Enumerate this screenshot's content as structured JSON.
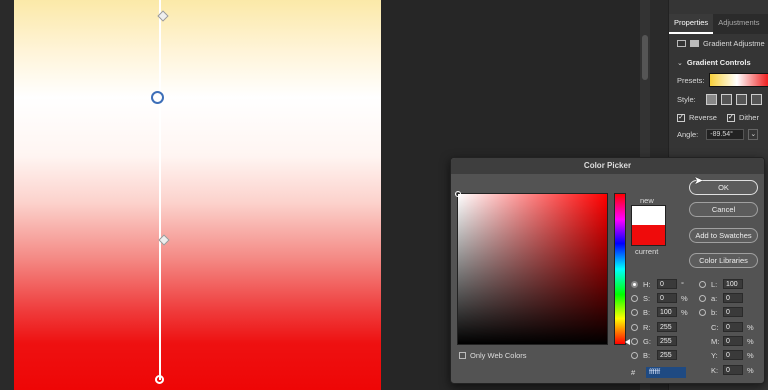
{
  "properties": {
    "tabs": [
      "Properties",
      "Adjustments"
    ],
    "layer_label": "Gradient Adjustme",
    "section_title": "Gradient Controls",
    "presets_label": "Presets:",
    "style_label": "Style:",
    "reverse_label": "Reverse",
    "dither_label": "Dither",
    "angle_label": "Angle:",
    "angle_value": "-89.54°"
  },
  "dialog": {
    "title": "Color Picker",
    "new_label": "new",
    "current_label": "current",
    "new_color": "#ffffff",
    "current_color": "#ef0b0b",
    "ok_label": "OK",
    "cancel_label": "Cancel",
    "add_swatches_label": "Add to Swatches",
    "color_libraries_label": "Color Libraries",
    "only_web_colors_label": "Only Web Colors",
    "hsb": {
      "h_label": "H:",
      "h_value": "0",
      "h_unit": "°",
      "s_label": "S:",
      "s_value": "0",
      "s_unit": "%",
      "b_label": "B:",
      "b_value": "100",
      "b_unit": "%"
    },
    "rgb": {
      "r_label": "R:",
      "r_value": "255",
      "g_label": "G:",
      "g_value": "255",
      "b_label": "B:",
      "b_value": "255"
    },
    "lab": {
      "l_label": "L:",
      "l_value": "100",
      "a_label": "a:",
      "a_value": "0",
      "b_label": "b:",
      "b_value": "0"
    },
    "cmyk": {
      "c_label": "C:",
      "c_value": "0",
      "m_label": "M:",
      "m_value": "0",
      "y_label": "Y:",
      "y_value": "0",
      "k_label": "K:",
      "k_value": "0",
      "unit": "%"
    },
    "hex_label": "#",
    "hex_value": "ffffff"
  }
}
